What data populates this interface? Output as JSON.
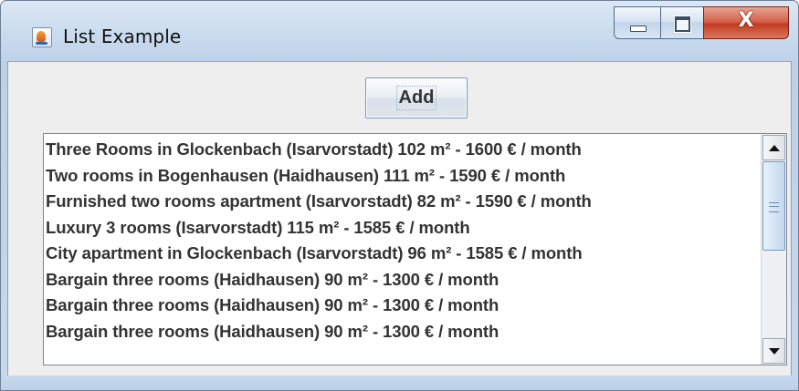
{
  "window": {
    "title": "List Example",
    "icon": "java-cup-icon",
    "controls": {
      "minimize": "minimize-icon",
      "maximize": "maximize-icon",
      "close_glyph": "X"
    }
  },
  "toolbar": {
    "add_label": "Add"
  },
  "list": {
    "items": [
      "Three Rooms in Glockenbach (Isarvorstadt) 102 m² - 1600 € / month",
      "Two rooms in Bogenhausen (Haidhausen) 111 m² - 1590 € / month",
      "Furnished two rooms apartment (Isarvorstadt) 82 m² - 1590 € / month",
      "Luxury 3 rooms (Isarvorstadt) 115 m² - 1585 € / month",
      "City apartment in Glockenbach (Isarvorstadt) 96 m² - 1585 € / month",
      "Bargain three rooms (Haidhausen) 90 m² - 1300 € / month",
      "Bargain three rooms (Haidhausen) 90 m² - 1300 € / month",
      "Bargain three rooms (Haidhausen) 90 m² - 1300 € / month"
    ]
  },
  "colors": {
    "frame": "#c9daee",
    "client_bg": "#eeeeee",
    "close_button": "#c23c22",
    "list_text": "#333333"
  }
}
